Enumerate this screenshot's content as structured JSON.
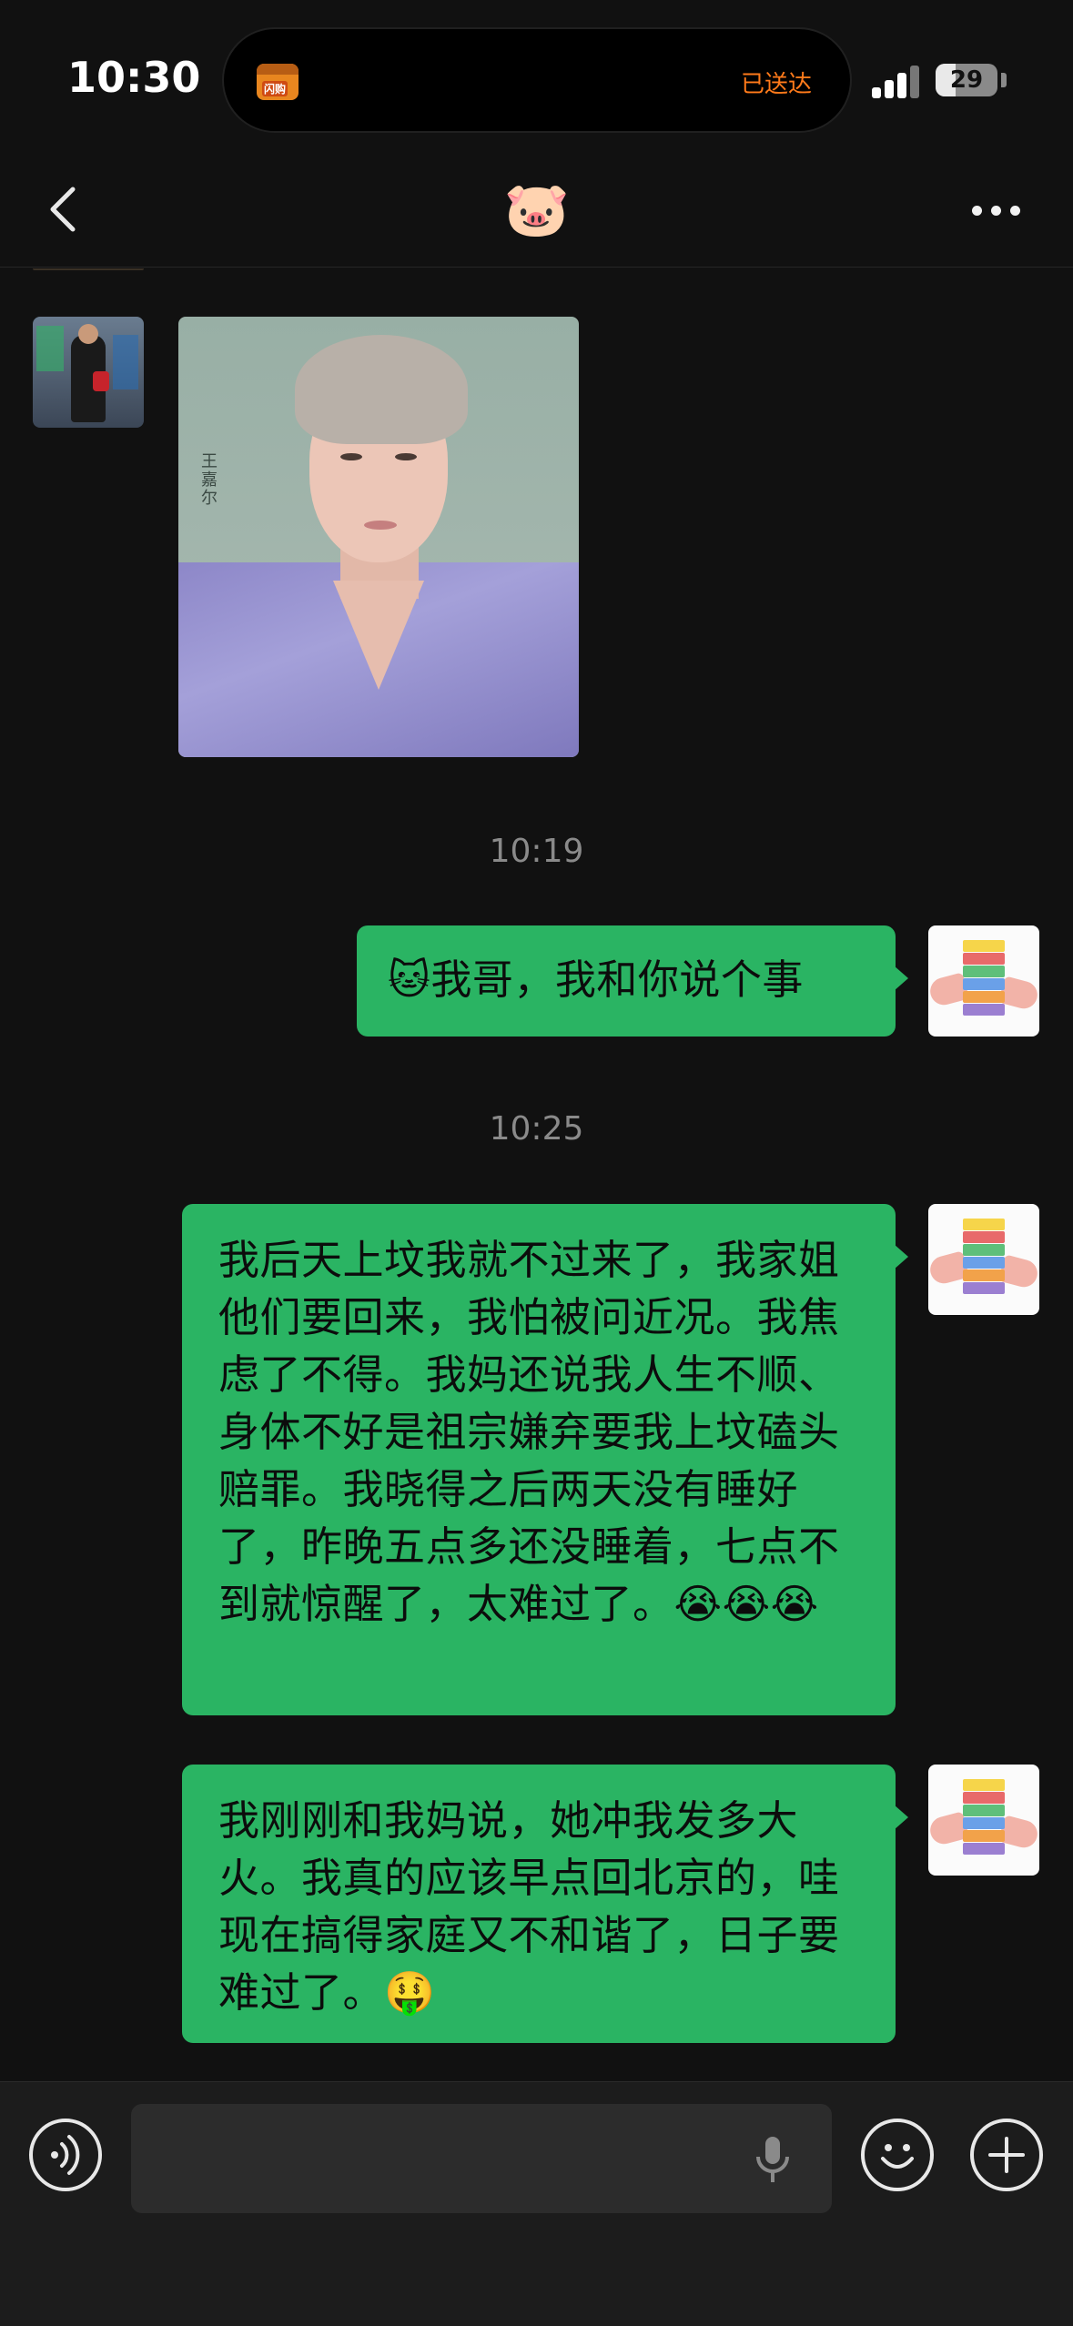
{
  "status_bar": {
    "time": "10:30",
    "island_app_tag": "闪购",
    "island_status": "已送达",
    "battery_level": "29"
  },
  "header": {
    "title": "🐷",
    "back_icon": "chevron-left-icon",
    "more_icon": "more-dots-icon"
  },
  "messages": {
    "photo_caption": "王嘉尔",
    "timestamp_1": "10:19",
    "msg_1": "🐱我哥，我和你说个事",
    "timestamp_2": "10:25",
    "msg_2": "我后天上坟我就不过来了，我家姐他们要回来，我怕被问近况。我焦虑了不得。我妈还说我人生不顺、身体不好是祖宗嫌弃要我上坟磕头赔罪。我晓得之后两天没有睡好了，昨晚五点多还没睡着，七点不到就惊醒了，太难过了。😭😭😭",
    "msg_3": "我刚刚和我妈说，她冲我发多大火。我真的应该早点回北京的，哇现在搞得家庭又不和谐了，日子要难过了。🤑"
  },
  "input_bar": {
    "placeholder": "",
    "voice_icon": "voice-icon",
    "mic_icon": "mic-icon",
    "emoji_icon": "emoji-icon",
    "plus_icon": "plus-icon"
  },
  "colors": {
    "bubble_green": "#2ab463",
    "background": "#111111",
    "island_status": "#ff7a1a"
  }
}
